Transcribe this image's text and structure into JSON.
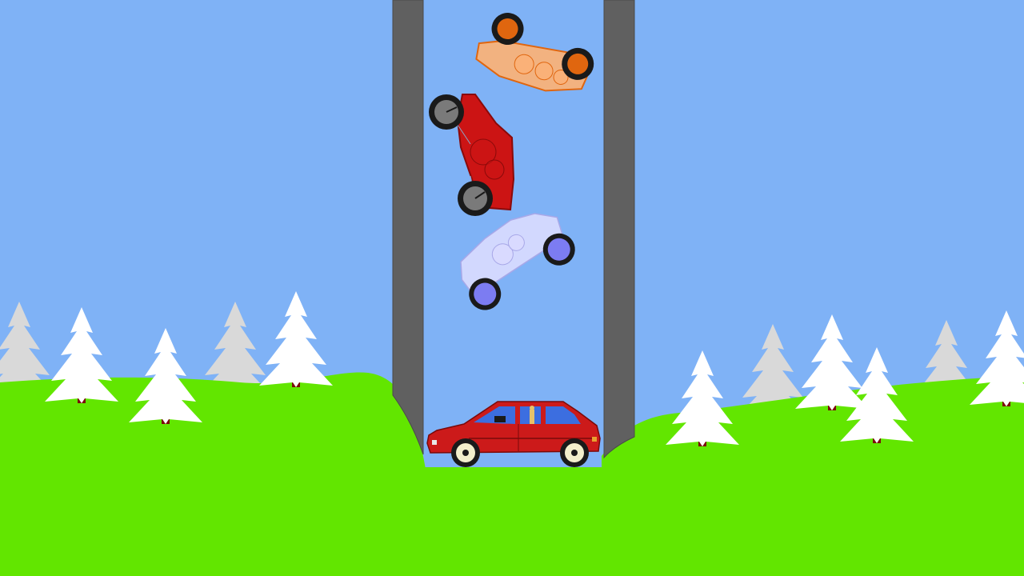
{
  "colors": {
    "sky": "#7fb2f6",
    "grass": "#62e600",
    "pillar": "#606060",
    "pillar_edge": "#4a4a4a",
    "tree_white": "#ffffff",
    "tree_grey": "#d9d9d9",
    "trunk": "#7a0c0c",
    "orange_body": "#ffb173",
    "orange_wheel": "#e0660f",
    "red_body": "#cc1414",
    "red_wheel": "#7a7a7a",
    "lilac_body": "#dcdcff",
    "lilac_wheel": "#7c7cf2",
    "car_body": "#cc1a1a",
    "car_window": "#3c6ee0",
    "car_hub": "#f3efcc"
  },
  "scene": {
    "terrain": "grass-hills",
    "shaft": "grey-pillars",
    "trees": "snowy-pine-trees"
  },
  "cars": [
    {
      "name": "orange-ragdoll-car",
      "state": "upside-down"
    },
    {
      "name": "red-ragdoll-car",
      "state": "tumbling"
    },
    {
      "name": "lilac-ragdoll-car",
      "state": "tumbling"
    },
    {
      "name": "red-hatchback-car",
      "state": "landed"
    }
  ]
}
